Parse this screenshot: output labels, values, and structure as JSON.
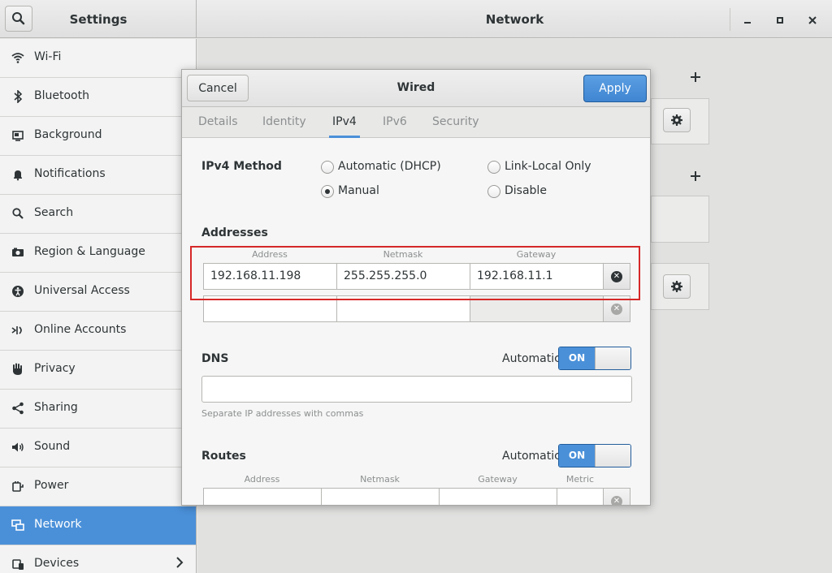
{
  "window": {
    "sidebar_title": "Settings",
    "main_title": "Network",
    "minimize_icon": "minimize-icon",
    "maximize_icon": "maximize-icon",
    "close_icon": "close-icon"
  },
  "sidebar": {
    "items": [
      {
        "label": "Wi-Fi",
        "icon": "wifi-icon"
      },
      {
        "label": "Bluetooth",
        "icon": "bluetooth-icon"
      },
      {
        "label": "Background",
        "icon": "background-icon"
      },
      {
        "label": "Notifications",
        "icon": "bell-icon"
      },
      {
        "label": "Search",
        "icon": "search-icon"
      },
      {
        "label": "Region & Language",
        "icon": "camera-icon"
      },
      {
        "label": "Universal Access",
        "icon": "accessibility-icon"
      },
      {
        "label": "Online Accounts",
        "icon": "online-accounts-icon"
      },
      {
        "label": "Privacy",
        "icon": "hand-icon"
      },
      {
        "label": "Sharing",
        "icon": "share-icon"
      },
      {
        "label": "Sound",
        "icon": "speaker-icon"
      },
      {
        "label": "Power",
        "icon": "power-icon"
      },
      {
        "label": "Network",
        "icon": "network-icon",
        "active": true
      },
      {
        "label": "Devices",
        "icon": "devices-icon"
      }
    ]
  },
  "dialog": {
    "cancel_label": "Cancel",
    "title": "Wired",
    "apply_label": "Apply",
    "tabs": [
      "Details",
      "Identity",
      "IPv4",
      "IPv6",
      "Security"
    ],
    "active_tab": "IPv4",
    "ipv4_method_label": "IPv4 Method",
    "methods": {
      "automatic_dhcp": "Automatic (DHCP)",
      "link_local": "Link-Local Only",
      "manual": "Manual",
      "disable": "Disable",
      "selected": "Manual"
    },
    "addresses": {
      "heading": "Addresses",
      "col_address": "Address",
      "col_netmask": "Netmask",
      "col_gateway": "Gateway",
      "rows": [
        {
          "address": "192.168.11.198",
          "netmask": "255.255.255.0",
          "gateway": "192.168.11.1"
        },
        {
          "address": "",
          "netmask": "",
          "gateway": ""
        }
      ]
    },
    "dns": {
      "heading": "DNS",
      "automatic_label": "Automatic",
      "switch_label": "ON",
      "value": "",
      "hint": "Separate IP addresses with commas"
    },
    "routes": {
      "heading": "Routes",
      "automatic_label": "Automatic",
      "switch_label": "ON",
      "col_address": "Address",
      "col_netmask": "Netmask",
      "col_gateway": "Gateway",
      "col_metric": "Metric"
    }
  },
  "colors": {
    "accent": "#4a90d9",
    "highlight_border": "#d62828"
  }
}
